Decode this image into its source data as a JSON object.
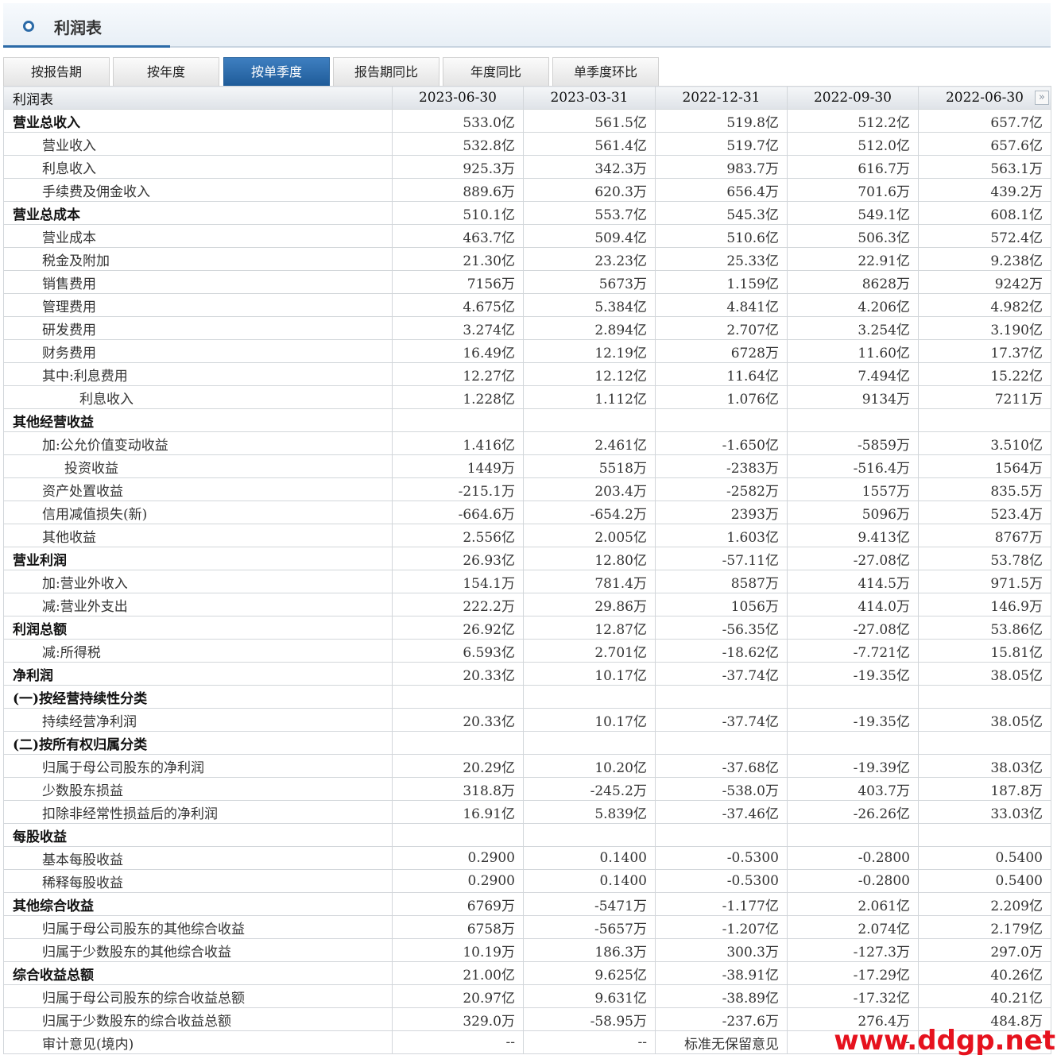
{
  "header": {
    "title": "利润表"
  },
  "tabs": [
    "按报告期",
    "按年度",
    "按单季度",
    "报告期同比",
    "年度同比",
    "单季度环比"
  ],
  "active_tab": 2,
  "table": {
    "corner_label": "利润表",
    "next_icon": "»",
    "periods": [
      "2023-06-30",
      "2023-03-31",
      "2022-12-31",
      "2022-09-30",
      "2022-06-30"
    ],
    "rows": [
      {
        "label": "营业总收入",
        "level": 0,
        "bold": true,
        "values": [
          "533.0亿",
          "561.5亿",
          "519.8亿",
          "512.2亿",
          "657.7亿"
        ]
      },
      {
        "label": "营业收入",
        "level": 1,
        "values": [
          "532.8亿",
          "561.4亿",
          "519.7亿",
          "512.0亿",
          "657.6亿"
        ]
      },
      {
        "label": "利息收入",
        "level": 1,
        "values": [
          "925.3万",
          "342.3万",
          "983.7万",
          "616.7万",
          "563.1万"
        ]
      },
      {
        "label": "手续费及佣金收入",
        "level": 1,
        "values": [
          "889.6万",
          "620.3万",
          "656.4万",
          "701.6万",
          "439.2万"
        ]
      },
      {
        "label": "营业总成本",
        "level": 0,
        "bold": true,
        "values": [
          "510.1亿",
          "553.7亿",
          "545.3亿",
          "549.1亿",
          "608.1亿"
        ]
      },
      {
        "label": "营业成本",
        "level": 1,
        "values": [
          "463.7亿",
          "509.4亿",
          "510.6亿",
          "506.3亿",
          "572.4亿"
        ]
      },
      {
        "label": "税金及附加",
        "level": 1,
        "values": [
          "21.30亿",
          "23.23亿",
          "25.33亿",
          "22.91亿",
          "9.238亿"
        ]
      },
      {
        "label": "销售费用",
        "level": 1,
        "values": [
          "7156万",
          "5673万",
          "1.159亿",
          "8628万",
          "9242万"
        ]
      },
      {
        "label": "管理费用",
        "level": 1,
        "values": [
          "4.675亿",
          "5.384亿",
          "4.841亿",
          "4.206亿",
          "4.982亿"
        ]
      },
      {
        "label": "研发费用",
        "level": 1,
        "values": [
          "3.274亿",
          "2.894亿",
          "2.707亿",
          "3.254亿",
          "3.190亿"
        ]
      },
      {
        "label": "财务费用",
        "level": 1,
        "values": [
          "16.49亿",
          "12.19亿",
          "6728万",
          "11.60亿",
          "17.37亿"
        ]
      },
      {
        "label": "其中:利息费用",
        "level": 1,
        "values": [
          "12.27亿",
          "12.12亿",
          "11.64亿",
          "7.494亿",
          "15.22亿"
        ]
      },
      {
        "label": "利息收入",
        "level": 3,
        "values": [
          "1.228亿",
          "1.112亿",
          "1.076亿",
          "9134万",
          "7211万"
        ]
      },
      {
        "label": "其他经营收益",
        "level": 0,
        "bold": true,
        "values": [
          "",
          "",
          "",
          "",
          ""
        ]
      },
      {
        "label": "加:公允价值变动收益",
        "level": 1,
        "values": [
          "1.416亿",
          "2.461亿",
          "-1.650亿",
          "-5859万",
          "3.510亿"
        ]
      },
      {
        "label": "投资收益",
        "level": 2,
        "values": [
          "1449万",
          "5518万",
          "-2383万",
          "-516.4万",
          "1564万"
        ]
      },
      {
        "label": "资产处置收益",
        "level": 1,
        "values": [
          "-215.1万",
          "203.4万",
          "-2582万",
          "1557万",
          "835.5万"
        ]
      },
      {
        "label": "信用减值损失(新)",
        "level": 1,
        "values": [
          "-664.6万",
          "-654.2万",
          "2393万",
          "5096万",
          "523.4万"
        ]
      },
      {
        "label": "其他收益",
        "level": 1,
        "values": [
          "2.556亿",
          "2.005亿",
          "1.603亿",
          "9.413亿",
          "8767万"
        ]
      },
      {
        "label": "营业利润",
        "level": 0,
        "bold": true,
        "values": [
          "26.93亿",
          "12.80亿",
          "-57.11亿",
          "-27.08亿",
          "53.78亿"
        ]
      },
      {
        "label": "加:营业外收入",
        "level": 1,
        "values": [
          "154.1万",
          "781.4万",
          "8587万",
          "414.5万",
          "971.5万"
        ]
      },
      {
        "label": "减:营业外支出",
        "level": 1,
        "values": [
          "222.2万",
          "29.86万",
          "1056万",
          "414.0万",
          "146.9万"
        ]
      },
      {
        "label": "利润总额",
        "level": 0,
        "bold": true,
        "values": [
          "26.92亿",
          "12.87亿",
          "-56.35亿",
          "-27.08亿",
          "53.86亿"
        ]
      },
      {
        "label": "减:所得税",
        "level": 1,
        "values": [
          "6.593亿",
          "2.701亿",
          "-18.62亿",
          "-7.721亿",
          "15.81亿"
        ]
      },
      {
        "label": "净利润",
        "level": 0,
        "bold": true,
        "values": [
          "20.33亿",
          "10.17亿",
          "-37.74亿",
          "-19.35亿",
          "38.05亿"
        ]
      },
      {
        "label": "(一)按经营持续性分类",
        "level": 0,
        "bold": true,
        "values": [
          "",
          "",
          "",
          "",
          ""
        ]
      },
      {
        "label": "持续经营净利润",
        "level": 1,
        "values": [
          "20.33亿",
          "10.17亿",
          "-37.74亿",
          "-19.35亿",
          "38.05亿"
        ]
      },
      {
        "label": "(二)按所有权归属分类",
        "level": 0,
        "bold": true,
        "values": [
          "",
          "",
          "",
          "",
          ""
        ]
      },
      {
        "label": "归属于母公司股东的净利润",
        "level": 1,
        "values": [
          "20.29亿",
          "10.20亿",
          "-37.68亿",
          "-19.39亿",
          "38.03亿"
        ]
      },
      {
        "label": "少数股东损益",
        "level": 1,
        "values": [
          "318.8万",
          "-245.2万",
          "-538.0万",
          "403.7万",
          "187.8万"
        ]
      },
      {
        "label": "扣除非经常性损益后的净利润",
        "level": 1,
        "values": [
          "16.91亿",
          "5.839亿",
          "-37.46亿",
          "-26.26亿",
          "33.03亿"
        ]
      },
      {
        "label": "每股收益",
        "level": 0,
        "bold": true,
        "values": [
          "",
          "",
          "",
          "",
          ""
        ]
      },
      {
        "label": "基本每股收益",
        "level": 1,
        "values": [
          "0.2900",
          "0.1400",
          "-0.5300",
          "-0.2800",
          "0.5400"
        ]
      },
      {
        "label": "稀释每股收益",
        "level": 1,
        "values": [
          "0.2900",
          "0.1400",
          "-0.5300",
          "-0.2800",
          "0.5400"
        ]
      },
      {
        "label": "其他综合收益",
        "level": 0,
        "bold": true,
        "values": [
          "6769万",
          "-5471万",
          "-1.177亿",
          "2.061亿",
          "2.209亿"
        ]
      },
      {
        "label": "归属于母公司股东的其他综合收益",
        "level": 1,
        "values": [
          "6758万",
          "-5657万",
          "-1.207亿",
          "2.074亿",
          "2.179亿"
        ]
      },
      {
        "label": "归属于少数股东的其他综合收益",
        "level": 1,
        "values": [
          "10.19万",
          "186.3万",
          "300.3万",
          "-127.3万",
          "297.0万"
        ]
      },
      {
        "label": "综合收益总额",
        "level": 0,
        "bold": true,
        "values": [
          "21.00亿",
          "9.625亿",
          "-38.91亿",
          "-17.29亿",
          "40.26亿"
        ]
      },
      {
        "label": "归属于母公司股东的综合收益总额",
        "level": 1,
        "values": [
          "20.97亿",
          "9.631亿",
          "-38.89亿",
          "-17.32亿",
          "40.21亿"
        ]
      },
      {
        "label": "归属于少数股东的综合收益总额",
        "level": 1,
        "values": [
          "329.0万",
          "-58.95万",
          "-237.6万",
          "276.4万",
          "484.8万"
        ]
      },
      {
        "label": "审计意见(境内)",
        "level": 1,
        "values": [
          "--",
          "--",
          "标准无保留意见",
          "--",
          "--"
        ]
      }
    ]
  },
  "watermark": "www.ddgp.net"
}
